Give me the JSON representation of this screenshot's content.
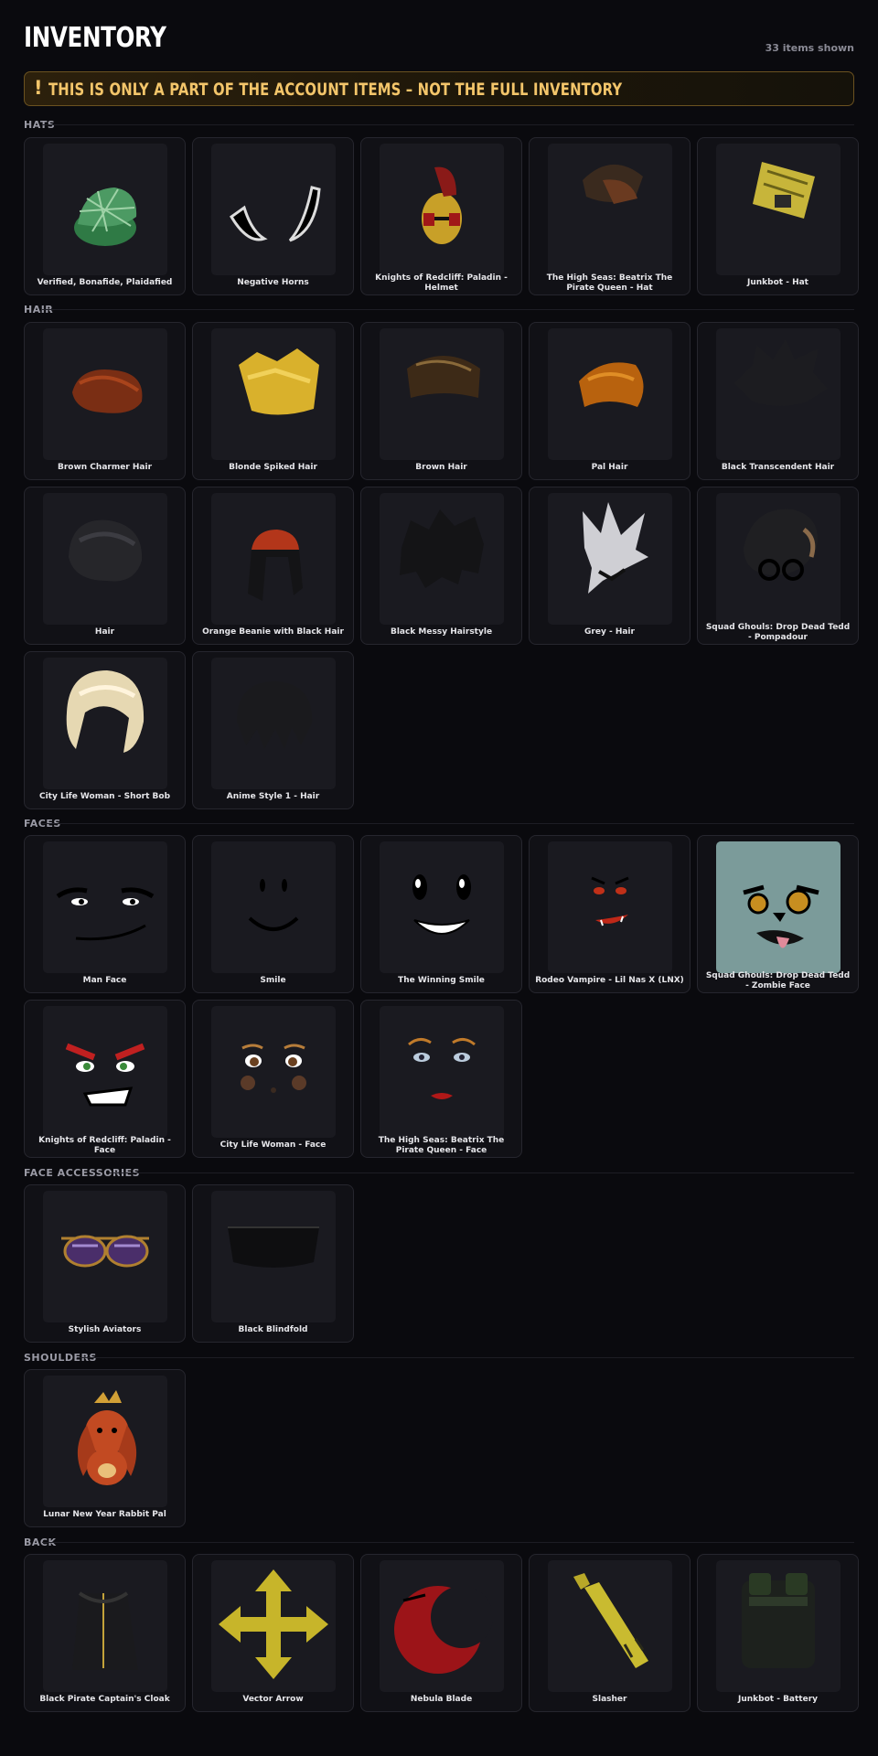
{
  "header": {
    "title": "INVENTORY",
    "count": "33 items shown"
  },
  "warning": {
    "icon": "!",
    "text": "THIS IS ONLY A PART OF THE ACCOUNT ITEMS – NOT THE FULL INVENTORY"
  },
  "colors": {
    "background": "#0a0a0e",
    "card": "#111116",
    "thumb": "#1a1a20",
    "warning_text": "#f3c56a",
    "warning_border": "#6b5220"
  },
  "sections": {
    "hats": {
      "label": "HATS",
      "items": [
        {
          "name": "Verified, Bonafide, Plaidafied",
          "icon": "green-plaid-cap"
        },
        {
          "name": "Negative Horns",
          "icon": "horns"
        },
        {
          "name": "Knights of Redcliff: Paladin - Helmet",
          "icon": "paladin-helmet"
        },
        {
          "name": "The High Seas: Beatrix The Pirate Queen - Hat",
          "icon": "pirate-hat"
        },
        {
          "name": "Junkbot - Hat",
          "icon": "junkbot-hat"
        }
      ]
    },
    "hair": {
      "label": "HAIR",
      "items": [
        {
          "name": "Brown Charmer Hair",
          "icon": "brown-hair"
        },
        {
          "name": "Blonde Spiked Hair",
          "icon": "blonde-hair"
        },
        {
          "name": "Brown Hair",
          "icon": "brown-hair-2"
        },
        {
          "name": "Pal Hair",
          "icon": "orange-hair"
        },
        {
          "name": "Black Transcendent Hair",
          "icon": "black-spiky-hair"
        },
        {
          "name": "Hair",
          "icon": "black-hair"
        },
        {
          "name": "Orange Beanie with Black Hair",
          "icon": "beanie-hair"
        },
        {
          "name": "Black Messy Hairstyle",
          "icon": "messy-hair"
        },
        {
          "name": "Grey - Hair",
          "icon": "grey-hair"
        },
        {
          "name": "Squad Ghouls: Drop Dead Tedd - Pompadour",
          "icon": "pompadour"
        },
        {
          "name": "City Life Woman - Short Bob",
          "icon": "blonde-bob"
        },
        {
          "name": "Anime Style 1 - Hair",
          "icon": "anime-hair"
        }
      ]
    },
    "faces": {
      "label": "FACES",
      "items": [
        {
          "name": "Man Face",
          "icon": "man-face"
        },
        {
          "name": "Smile",
          "icon": "smile-face"
        },
        {
          "name": "The Winning Smile",
          "icon": "winning-smile"
        },
        {
          "name": "Rodeo Vampire - Lil Nas X (LNX)",
          "icon": "vampire-face"
        },
        {
          "name": "Squad Ghouls: Drop Dead Tedd - Zombie Face",
          "icon": "zombie-face"
        },
        {
          "name": "Knights of Redcliff: Paladin - Face",
          "icon": "paladin-face"
        },
        {
          "name": "City Life Woman - Face",
          "icon": "woman-face"
        },
        {
          "name": "The High Seas: Beatrix The Pirate Queen - Face",
          "icon": "pirate-queen-face"
        }
      ]
    },
    "face_accessories": {
      "label": "FACE ACCESSORIES",
      "items": [
        {
          "name": "Stylish Aviators",
          "icon": "aviators"
        },
        {
          "name": "Black Blindfold",
          "icon": "blindfold"
        }
      ]
    },
    "shoulders": {
      "label": "SHOULDERS",
      "items": [
        {
          "name": "Lunar New Year Rabbit Pal",
          "icon": "rabbit-pal"
        }
      ]
    },
    "back": {
      "label": "BACK",
      "items": [
        {
          "name": "Black Pirate Captain's Cloak",
          "icon": "cloak"
        },
        {
          "name": "Vector Arrow",
          "icon": "vector-arrow"
        },
        {
          "name": "Nebula Blade",
          "icon": "nebula-blade"
        },
        {
          "name": "Slasher",
          "icon": "slasher"
        },
        {
          "name": "Junkbot - Battery",
          "icon": "battery"
        }
      ]
    }
  }
}
